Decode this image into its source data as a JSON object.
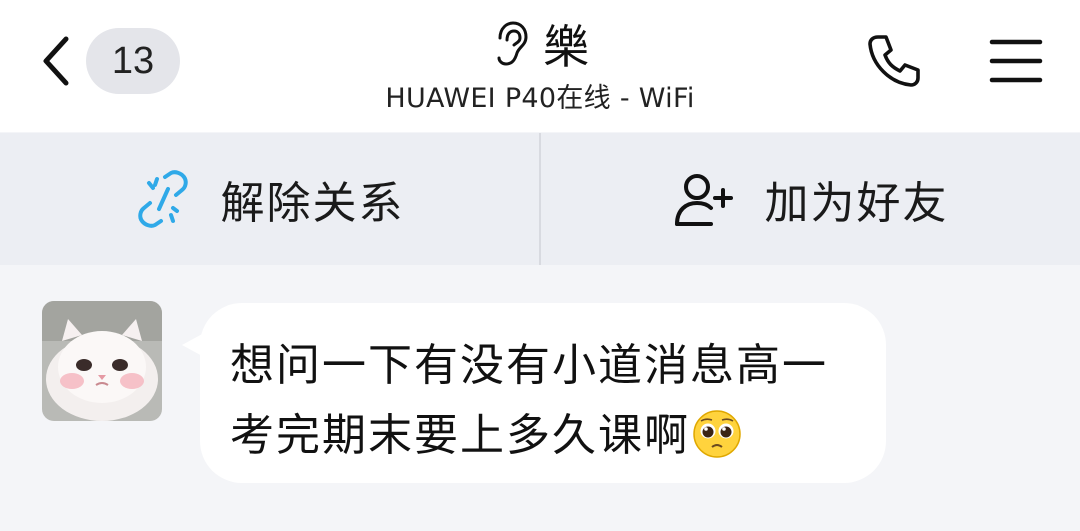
{
  "header": {
    "unread_count": "13",
    "contact_name": "樂",
    "device_status": "HUAWEI P40在线 - WiFi",
    "icons": {
      "back": "chevron-left-icon",
      "listen_mode": "ear-icon",
      "call": "phone-icon",
      "menu": "hamburger-menu-icon"
    }
  },
  "actions": {
    "unlink_label": "解除关系",
    "add_friend_label": "加为好友",
    "icons": {
      "unlink": "broken-link-icon",
      "add_friend": "add-user-icon"
    },
    "accent_color": "#2fa9e8"
  },
  "messages": [
    {
      "sender": "incoming",
      "text": "想问一下有没有小道消息高一考完期末要上多久课啊",
      "emoji": "pleading-face-emoji"
    }
  ]
}
